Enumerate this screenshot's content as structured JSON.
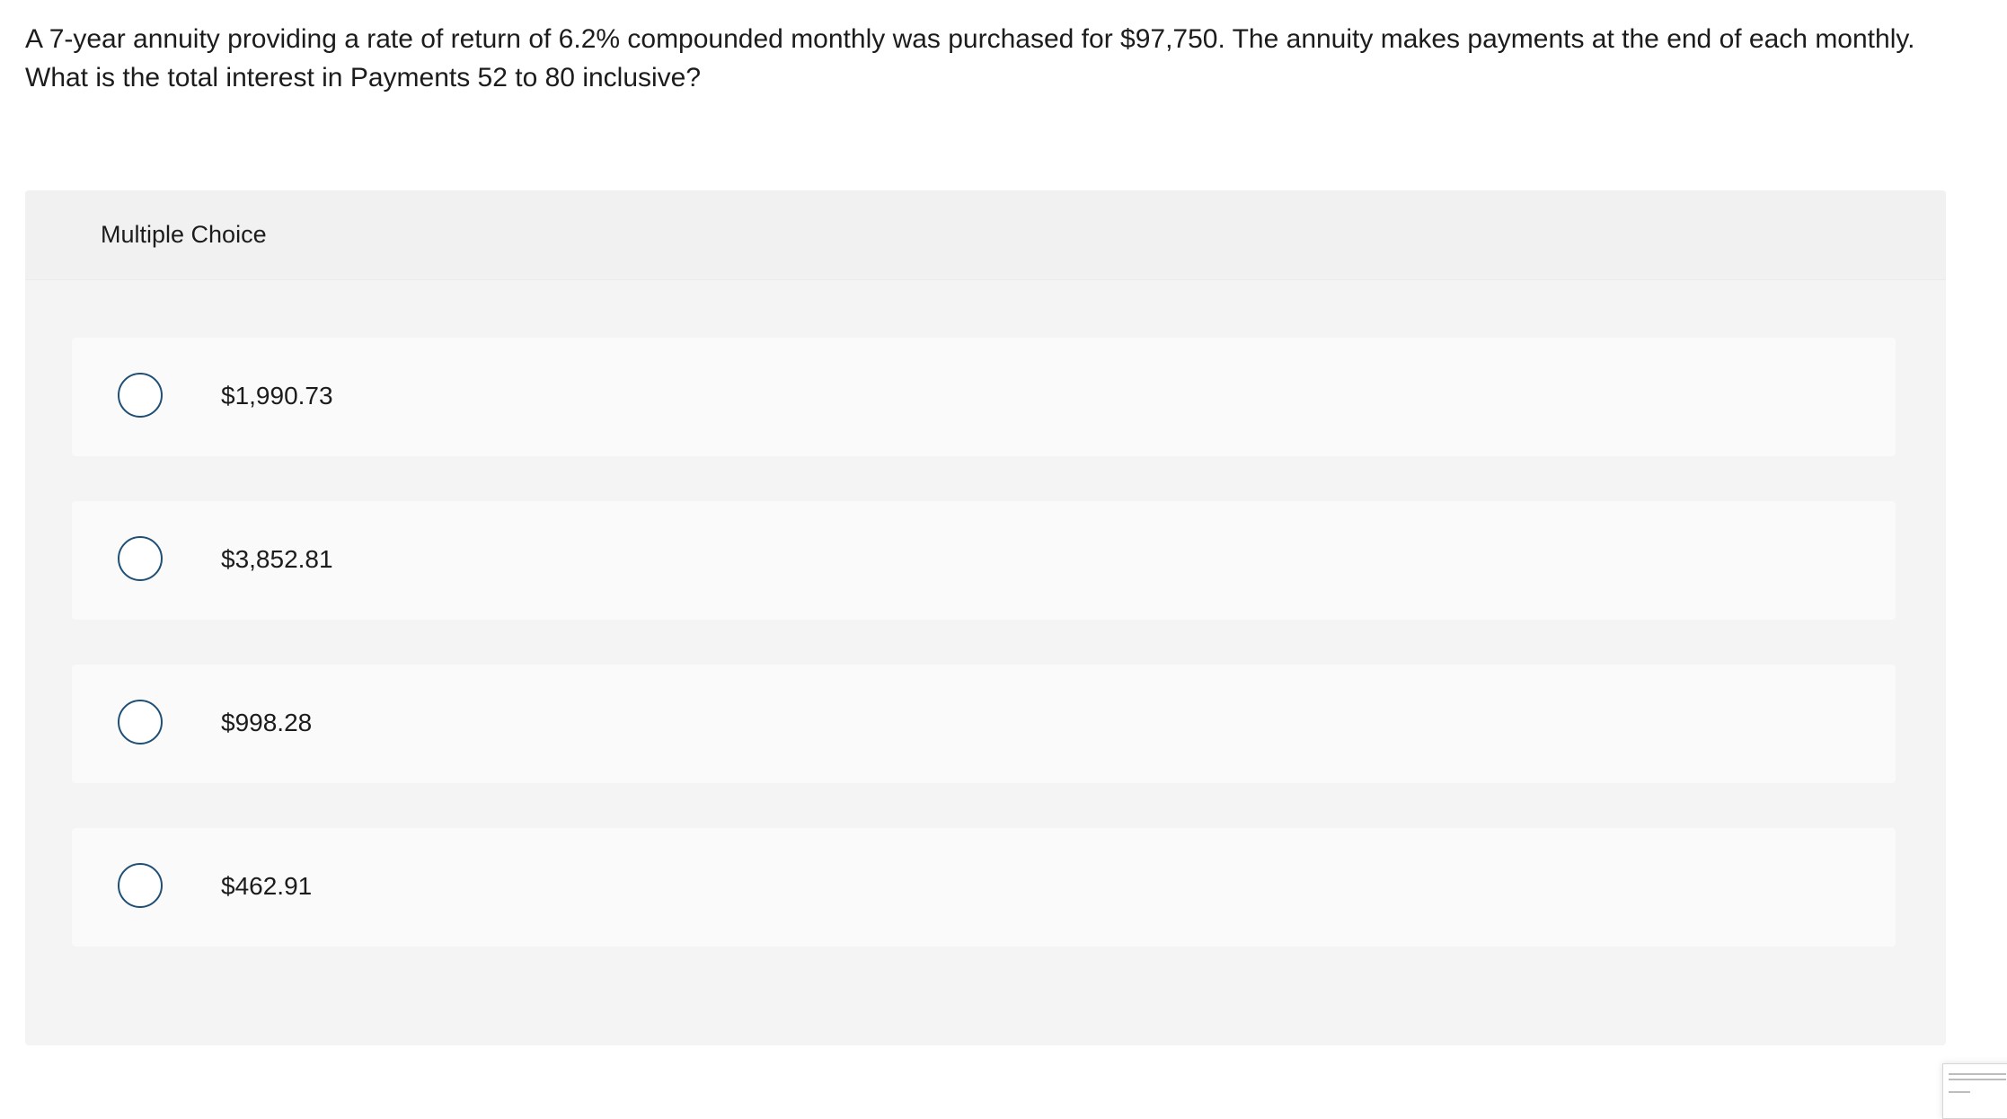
{
  "question": {
    "text": "A 7-year annuity providing a rate of return of 6.2% compounded monthly was purchased for $97,750. The annuity makes payments at the end of each monthly. What is the total interest in Payments 52 to 80 inclusive?"
  },
  "multiple_choice": {
    "title": "Multiple Choice",
    "options": [
      {
        "label": "$1,990.73"
      },
      {
        "label": "$3,852.81"
      },
      {
        "label": "$998.28"
      },
      {
        "label": "$462.91"
      }
    ]
  },
  "colors": {
    "radio_border": "#1f4f76",
    "panel_background": "#f4f4f4",
    "option_background": "#fafafa"
  }
}
